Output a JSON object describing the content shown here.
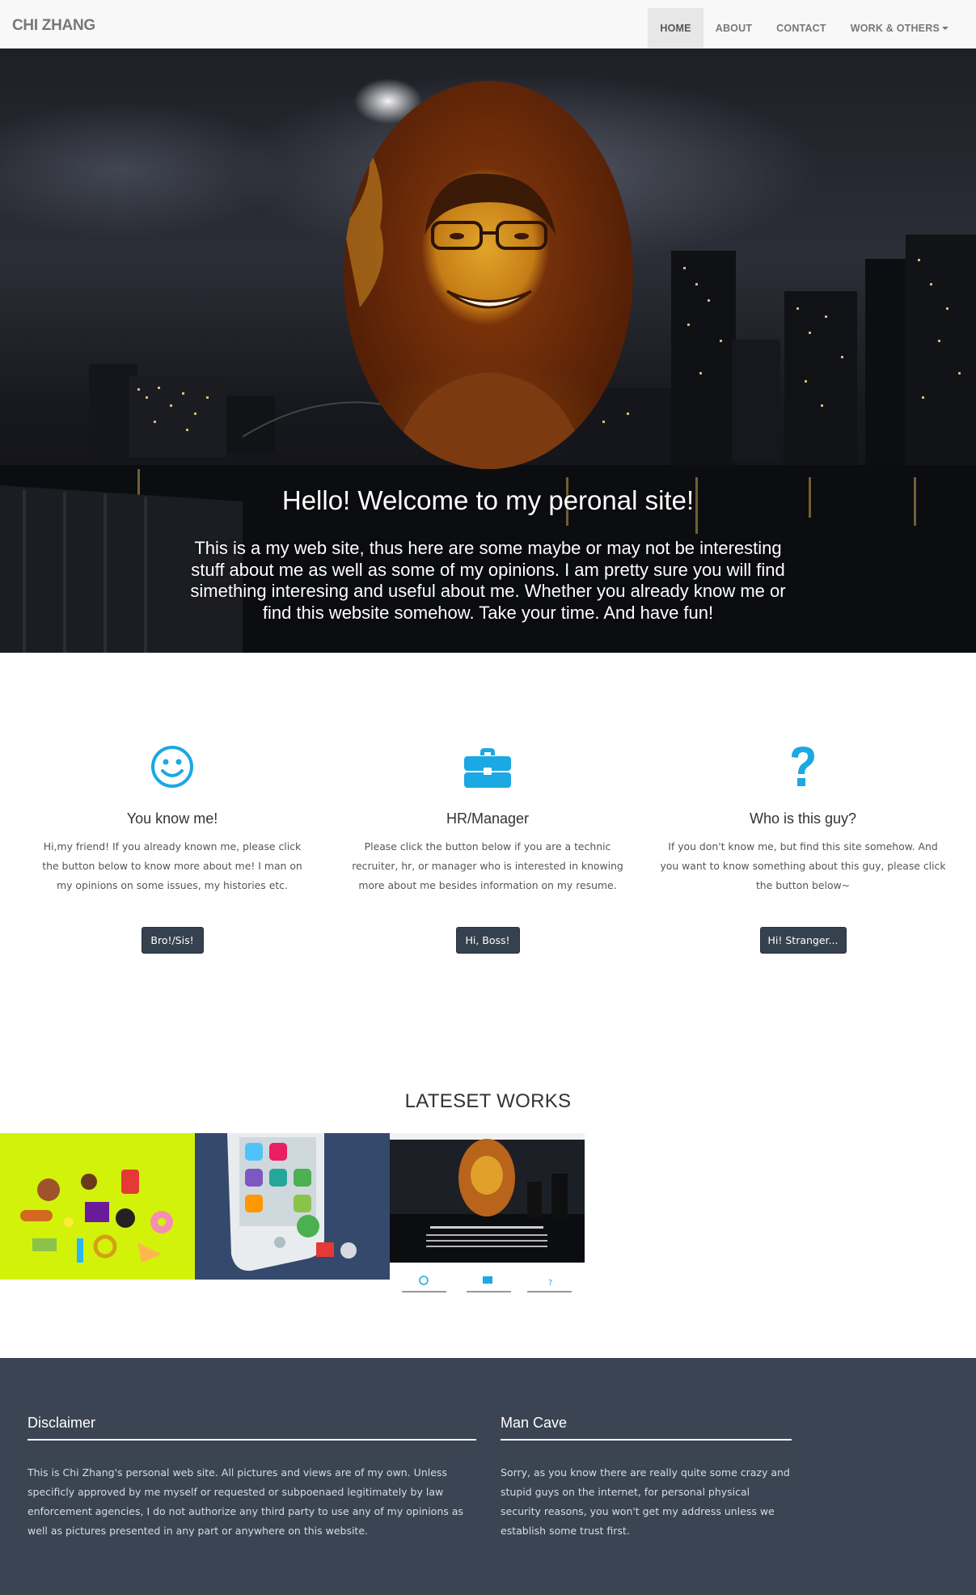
{
  "navbar": {
    "brand": "CHI ZHANG",
    "items": [
      {
        "label": "HOME",
        "active": true
      },
      {
        "label": "ABOUT"
      },
      {
        "label": "CONTACT"
      },
      {
        "label": "WORK & OTHERS",
        "dropdown": true
      }
    ]
  },
  "hero": {
    "title": "Hello! Welcome to my peronal site!",
    "text": "This is a my web site, thus here are some maybe or may not be interesting stuff about me as well as some of my opinions. I am pretty sure you will find simething interesing and useful about me. Whether you already know me or find this website somehow. Take your time. And have fun!"
  },
  "features": [
    {
      "icon": "smile-icon",
      "title": "You know me!",
      "text": "Hi,my friend! If you already known me, please click the button below to know more about me! I man on my opinions on some issues, my histories etc.",
      "button": "Bro!/Sis!"
    },
    {
      "icon": "briefcase-icon",
      "title": "HR/Manager",
      "text": "Please click the button below if you are a technic recruiter, hr, or manager who is interested in knowing more about me besides information on my resume.",
      "button": "Hi, Boss!"
    },
    {
      "icon": "question-icon",
      "title": "Who is this guy?",
      "text": "If you don't know me, but find this site somehow. And you want to know something about this guy, please click the button below~",
      "button": "Hi! Stranger..."
    }
  ],
  "works": {
    "title": "LATESET WORKS"
  },
  "footer": {
    "disclaimer_title": "Disclaimer",
    "disclaimer_text": "This is Chi Zhang's personal web site. All pictures and views are of my own. Unless specificly approved by me myself or requested or subpoenaed legitimately by law enforcement agencies, I do not authorize any third party to use any of my opinions as well as pictures presented in any part or anywhere on this website.",
    "mancave_title": "Man Cave",
    "mancave_text": "Sorry, as you know there are really quite some crazy and stupid guys on the internet, for personal physical security reasons, you won't get my address unless we establish some trust first."
  },
  "colors": {
    "accent": "#1ca8e3",
    "button": "#36414f",
    "footer": "#3a4452",
    "thumb_green": "#d3f20a",
    "thumb_navy": "#34496b"
  }
}
